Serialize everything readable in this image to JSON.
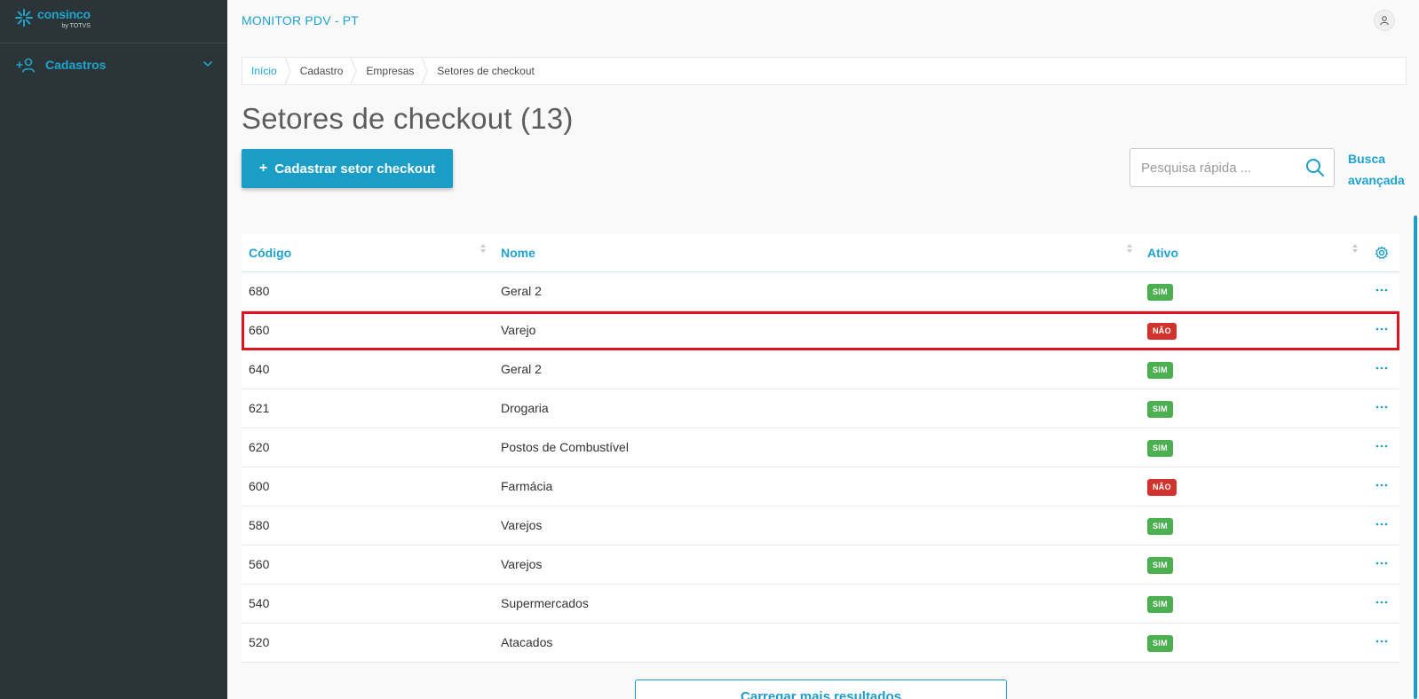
{
  "brand": {
    "name": "consinco",
    "sub": "by TOTVS"
  },
  "sidebar": {
    "items": [
      {
        "label": "Cadastros"
      }
    ]
  },
  "header": {
    "title": "MONITOR PDV - PT"
  },
  "breadcrumb": [
    "Início",
    "Cadastro",
    "Empresas",
    "Setores de checkout"
  ],
  "page": {
    "title": "Setores de checkout (13)"
  },
  "toolbar": {
    "add_label": "Cadastrar setor checkout",
    "add_icon": "+"
  },
  "search": {
    "placeholder": "Pesquisa rápida ...",
    "value": "",
    "advanced_label_line1": "Busca",
    "advanced_label_line2": "avançada"
  },
  "table": {
    "columns": [
      "Código",
      "Nome",
      "Ativo"
    ],
    "rows": [
      {
        "codigo": "680",
        "nome": "Geral 2",
        "ativo": "SIM"
      },
      {
        "codigo": "660",
        "nome": "Varejo",
        "ativo": "NÃO"
      },
      {
        "codigo": "640",
        "nome": "Geral 2",
        "ativo": "SIM"
      },
      {
        "codigo": "621",
        "nome": "Drogaria",
        "ativo": "SIM"
      },
      {
        "codigo": "620",
        "nome": "Postos de Combustível",
        "ativo": "SIM"
      },
      {
        "codigo": "600",
        "nome": "Farmácia",
        "ativo": "NÃO"
      },
      {
        "codigo": "580",
        "nome": "Varejos",
        "ativo": "SIM"
      },
      {
        "codigo": "560",
        "nome": "Varejos",
        "ativo": "SIM"
      },
      {
        "codigo": "540",
        "nome": "Supermercados",
        "ativo": "SIM"
      },
      {
        "codigo": "520",
        "nome": "Atacados",
        "ativo": "SIM"
      }
    ]
  },
  "load_more_label": "Carregar mais resultados",
  "colors": {
    "accent": "#1fa3cf",
    "sidebar_bg": "#2b3537",
    "sim": "#4caf50",
    "nao": "#d0342c",
    "highlight": "#e0141e"
  }
}
